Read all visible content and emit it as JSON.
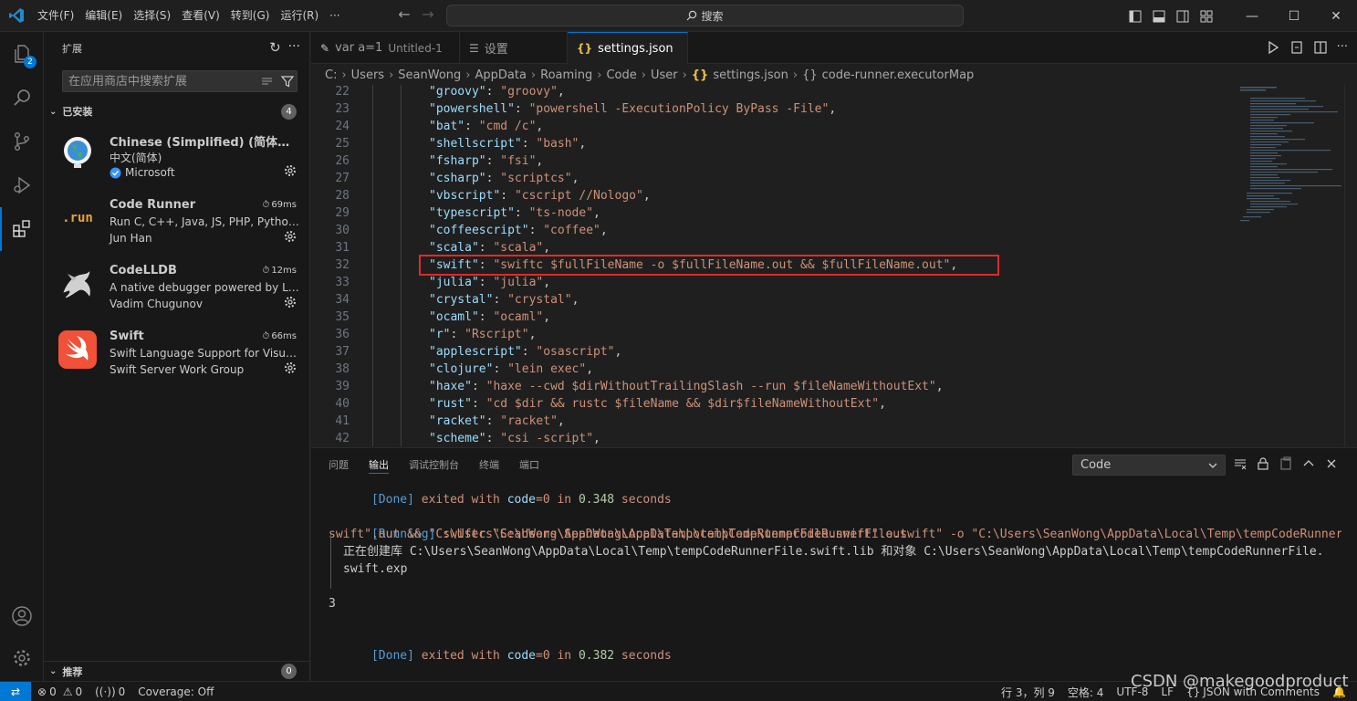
{
  "menu": [
    "文件(F)",
    "编辑(E)",
    "选择(S)",
    "查看(V)",
    "转到(G)",
    "运行(R)",
    "···"
  ],
  "command_center": {
    "label": "搜索"
  },
  "activity": {
    "explorer_badge": "2"
  },
  "sidebar": {
    "title": "扩展",
    "search_placeholder": "在应用商店中搜索扩展",
    "installed_label": "已安装",
    "installed_count": "4",
    "recommended_label": "推荐",
    "recommended_count": "0",
    "extensions": [
      {
        "name": "Chinese (Simplified) (简体中文) ...",
        "desc": "中文(简体)",
        "publisher": "Microsoft",
        "time": "",
        "verified": true,
        "icon": "globe-icon"
      },
      {
        "name": "Code Runner",
        "desc": "Run C, C++, Java, JS, PHP, Python, ...",
        "publisher": "Jun Han",
        "time": "69ms",
        "icon": "run-logo-icon"
      },
      {
        "name": "CodeLLDB",
        "desc": "A native debugger powered by LL...",
        "publisher": "Vadim Chugunov",
        "time": "12ms",
        "icon": "dragon-icon"
      },
      {
        "name": "Swift",
        "desc": "Swift Language Support for Visual ...",
        "publisher": "Swift Server Work Group",
        "time": "66ms",
        "icon": "swift-logo-icon"
      }
    ]
  },
  "tabs": [
    {
      "label": "var a=1",
      "sub": "Untitled-1",
      "dirty": true,
      "icon": "js-file-icon"
    },
    {
      "label": "设置",
      "icon": "settings-list-icon"
    },
    {
      "label": "settings.json",
      "dirty": true,
      "active": true,
      "icon": "json-braces-icon"
    }
  ],
  "breadcrumb": [
    "C:",
    "Users",
    "SeanWong",
    "AppData",
    "Roaming",
    "Code",
    "User",
    "settings.json",
    "code-runner.executorMap"
  ],
  "code_lines": [
    {
      "n": "22",
      "k": "\"groovy\"",
      "v": "\"groovy\""
    },
    {
      "n": "23",
      "k": "\"powershell\"",
      "v": "\"powershell -ExecutionPolicy ByPass -File\""
    },
    {
      "n": "24",
      "k": "\"bat\"",
      "v": "\"cmd /c\""
    },
    {
      "n": "25",
      "k": "\"shellscript\"",
      "v": "\"bash\""
    },
    {
      "n": "26",
      "k": "\"fsharp\"",
      "v": "\"fsi\""
    },
    {
      "n": "27",
      "k": "\"csharp\"",
      "v": "\"scriptcs\""
    },
    {
      "n": "28",
      "k": "\"vbscript\"",
      "v": "\"cscript //Nologo\""
    },
    {
      "n": "29",
      "k": "\"typescript\"",
      "v": "\"ts-node\""
    },
    {
      "n": "30",
      "k": "\"coffeescript\"",
      "v": "\"coffee\""
    },
    {
      "n": "31",
      "k": "\"scala\"",
      "v": "\"scala\""
    },
    {
      "n": "32",
      "k": "\"swift\"",
      "v": "\"swiftc $fullFileName -o $fullFileName.out && $fullFileName.out\""
    },
    {
      "n": "33",
      "k": "\"julia\"",
      "v": "\"julia\""
    },
    {
      "n": "34",
      "k": "\"crystal\"",
      "v": "\"crystal\""
    },
    {
      "n": "35",
      "k": "\"ocaml\"",
      "v": "\"ocaml\""
    },
    {
      "n": "36",
      "k": "\"r\"",
      "v": "\"Rscript\""
    },
    {
      "n": "37",
      "k": "\"applescript\"",
      "v": "\"osascript\""
    },
    {
      "n": "38",
      "k": "\"clojure\"",
      "v": "\"lein exec\""
    },
    {
      "n": "39",
      "k": "\"haxe\"",
      "v": "\"haxe --cwd $dirWithoutTrailingSlash --run $fileNameWithoutExt\""
    },
    {
      "n": "40",
      "k": "\"rust\"",
      "v": "\"cd $dir && rustc $fileName && $dir$fileNameWithoutExt\""
    },
    {
      "n": "41",
      "k": "\"racket\"",
      "v": "\"racket\""
    },
    {
      "n": "42",
      "k": "\"scheme\"",
      "v": "\"csi -script\""
    }
  ],
  "panel": {
    "tabs": [
      "问题",
      "输出",
      "调试控制台",
      "终端",
      "端口"
    ],
    "active_tab": "输出",
    "channel": "Code",
    "output": {
      "done1": {
        "tag": "[Done]",
        "text": " exited with ",
        "key": "code",
        "eq": "=0 in ",
        "num": "0.348",
        "tail": " seconds"
      },
      "running_tag": "[Running]",
      "running_cmd1": " swiftc \"C:\\Users\\SeanWong\\AppData\\Local\\Temp\\tempCodeRunnerFile.swift\" -o \"C:\\Users\\SeanWong\\AppData\\Local\\Temp\\tempCodeRunnerFile.",
      "running_cmd2": "swift\".out && \"C:\\Users\\SeanWong\\AppData\\Local\\Temp\\tempCodeRunnerFile.swift\".out",
      "lib_line1": "正在创建库 C:\\Users\\SeanWong\\AppData\\Local\\Temp\\tempCodeRunnerFile.swift.lib 和对象 C:\\Users\\SeanWong\\AppData\\Local\\Temp\\tempCodeRunnerFile.",
      "lib_line2": "swift.exp",
      "result": "3",
      "done2": {
        "tag": "[Done]",
        "text": " exited with ",
        "key": "code",
        "eq": "=0 in ",
        "num": "0.382",
        "tail": " seconds"
      }
    }
  },
  "statusbar": {
    "errors": "0",
    "warnings": "0",
    "ports": "0",
    "coverage": "Coverage: Off",
    "position": "行 3，列 9",
    "spaces": "空格: 4",
    "encoding": "UTF-8",
    "eol": "LF",
    "language": "JSON with Comments"
  },
  "watermark": "CSDN @makegoodproduct"
}
